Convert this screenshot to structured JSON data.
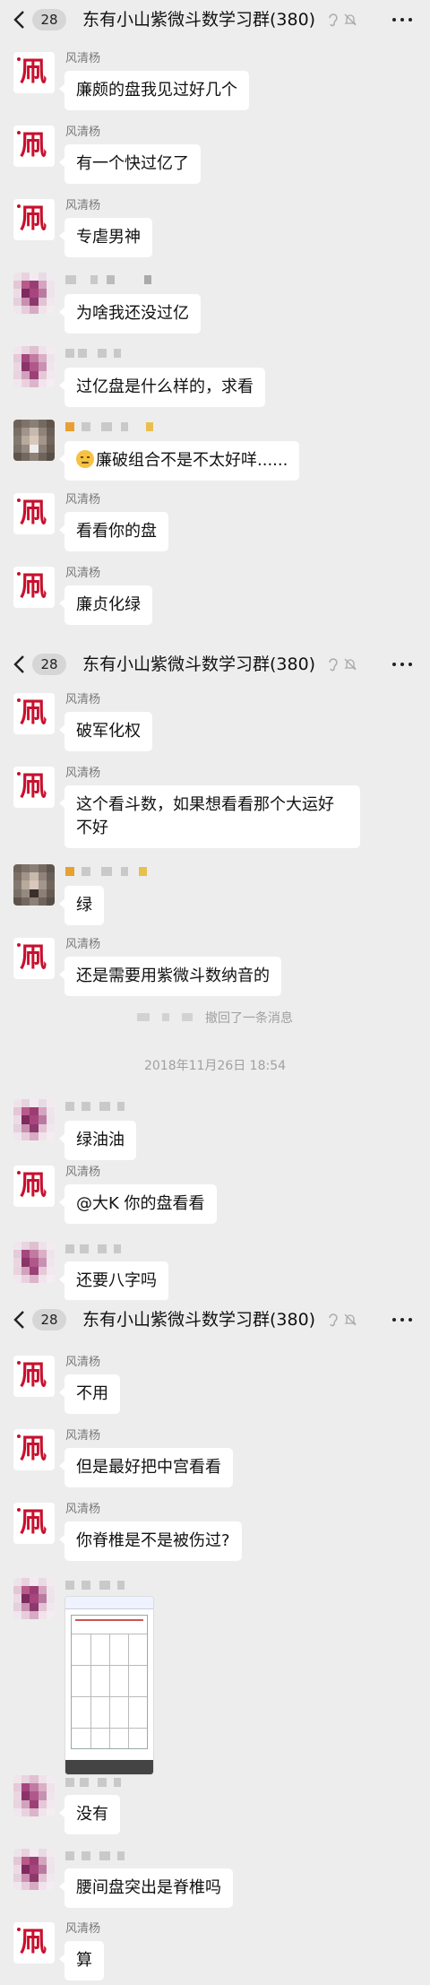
{
  "header": {
    "unread": "28",
    "title": "东有小山紫微斗数学习群(380)"
  },
  "sender_name": "风清杨",
  "avatar_char": "凧",
  "messages": {
    "m1": "廉颇的盘我见过好几个",
    "m2": "有一个快过亿了",
    "m3": "专虐男神",
    "m4": "为啥我还没过亿",
    "m5": "过亿盘是什么样的，求看",
    "m6": "廉破组合不是不太好咩......",
    "m7": "看看你的盘",
    "m8": "廉贞化绿",
    "m9": "破军化权",
    "m10": "这个看斗数，如果想看看那个大运好不好",
    "m11": "绿",
    "m12": "还是需要用紫微斗数纳音的",
    "m13": "绿油油",
    "m14": "@大K 你的盘看看",
    "m15": "还要八字吗",
    "m16": "不用",
    "m17": "但是最好把中宫看看",
    "m18": "你脊椎是不是被伤过?",
    "m19": "没有",
    "m20": "腰间盘突出是脊椎吗",
    "m21": "算"
  },
  "system": {
    "recall": "撤回了一条消息",
    "timestamp": "2018年11月26日 18:54"
  },
  "icons": {
    "back": "chevron-left-icon",
    "ear": "ear-icon",
    "mute": "bell-slash-icon",
    "more": "more-icon"
  },
  "colors": {
    "background": "#ededed",
    "bubble": "#ffffff",
    "avatar_glyph": "#c8102e"
  }
}
